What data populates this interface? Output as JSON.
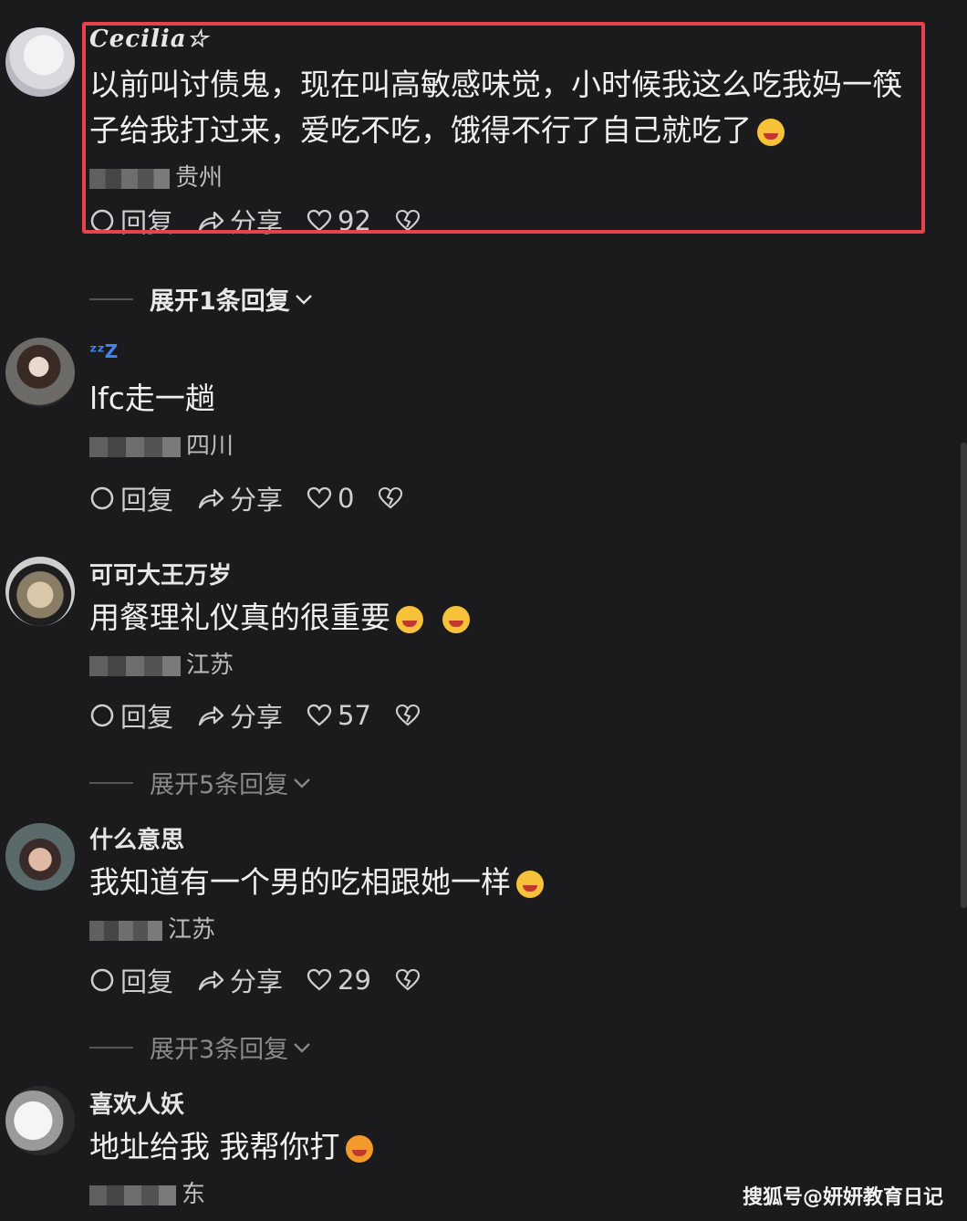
{
  "comments": [
    {
      "username": "Cecilia☆",
      "text": "以前叫讨债鬼，现在叫高敏感味觉，小时候我这么吃我妈一筷子给我打过来，爱吃不吃，饿得不行了自己就吃了",
      "emoji": "laughing-crying-emoji",
      "location_visible": "贵州",
      "reply_label": "回复",
      "share_label": "分享",
      "likes": "92",
      "expand_label": "展开1条回复"
    },
    {
      "username": "ᶻᶻZ",
      "text": "lfc走一趟",
      "location_visible": "四川",
      "reply_label": "回复",
      "share_label": "分享",
      "likes": "0"
    },
    {
      "username": "可可大王万岁",
      "text": "用餐理礼仪真的很重要",
      "emoji": "grimace-emoji",
      "location_visible": "江苏",
      "reply_label": "回复",
      "share_label": "分享",
      "likes": "57",
      "expand_label": "展开5条回复"
    },
    {
      "username": "什么意思",
      "text": "我知道有一个男的吃相跟她一样",
      "emoji": "dizzy-face-emoji",
      "location_visible": "江苏",
      "reply_label": "回复",
      "share_label": "分享",
      "likes": "29",
      "expand_label": "展开3条回复"
    },
    {
      "username": "喜欢人妖",
      "text": "地址给我 我帮你打",
      "emoji": "tongue-face-emoji",
      "location_visible": "东"
    }
  ],
  "watermark": "搜狐号@妍妍教育日记",
  "colors": {
    "background": "#1b1b1d",
    "highlight_border": "#e8434a"
  }
}
